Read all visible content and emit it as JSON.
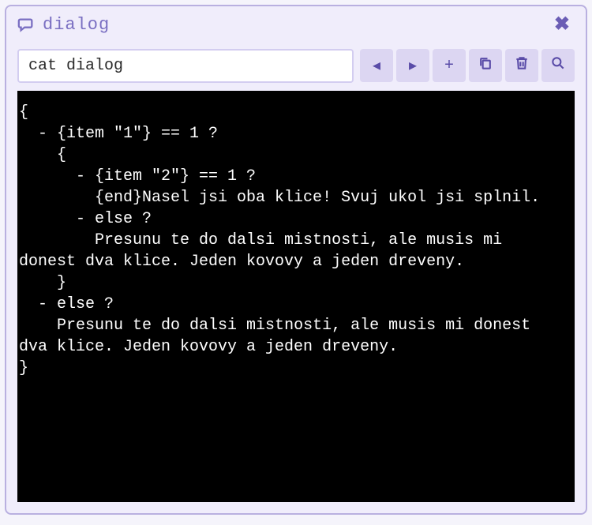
{
  "titlebar": {
    "title": "dialog"
  },
  "toolbar": {
    "command": "cat dialog",
    "buttons": {
      "prev": "◂",
      "next": "▸",
      "add": "+",
      "copy": "copy",
      "delete": "delete",
      "search": "search"
    }
  },
  "console": {
    "content": "{\n  - {item \"1\"} == 1 ?\n    {\n      - {item \"2\"} == 1 ?\n        {end}Nasel jsi oba klice! Svuj ukol jsi splnil.\n      - else ?\n        Presunu te do dalsi mistnosti, ale musis mi donest dva klice. Jeden kovovy a jeden dreveny.\n    }\n  - else ?\n    Presunu te do dalsi mistnosti, ale musis mi donest dva klice. Jeden kovovy a jeden dreveny.\n}"
  }
}
